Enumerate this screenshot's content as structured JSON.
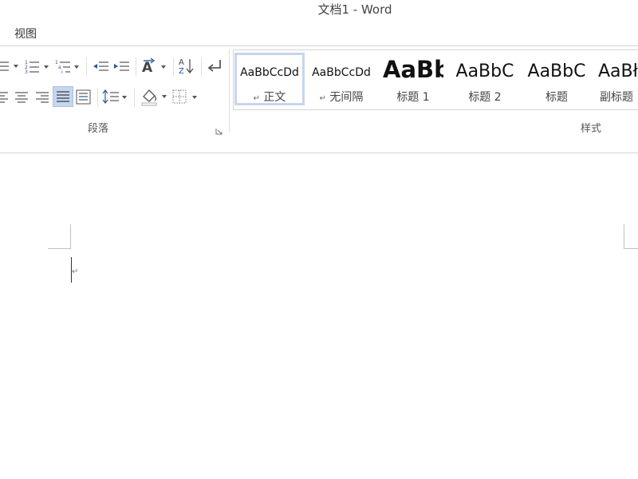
{
  "window": {
    "title": "文档1 - Word"
  },
  "tabs": {
    "view": "视图"
  },
  "ribbon": {
    "paragraph_group": {
      "label": "段落"
    },
    "styles_group": {
      "label": "样式",
      "styles": [
        {
          "sample": "AaBbCcDd",
          "name": "正文",
          "mark": "↵",
          "selected": true
        },
        {
          "sample": "AaBbCcDd",
          "name": "无间隔",
          "mark": "↵",
          "selected": false
        },
        {
          "sample": "AaBb",
          "name": "标题 1",
          "mark": "",
          "selected": false
        },
        {
          "sample": "AaBbC",
          "name": "标题 2",
          "mark": "",
          "selected": false
        },
        {
          "sample": "AaBbC",
          "name": "标题",
          "mark": "",
          "selected": false
        },
        {
          "sample": "AaBł",
          "name": "副标题",
          "mark": "",
          "selected": false
        }
      ]
    }
  },
  "document": {
    "paragraph_mark": "↵"
  },
  "colors": {
    "accent": "#2b579a",
    "selected_bg": "#c5d6ee",
    "selected_border": "#a8c2e8"
  }
}
